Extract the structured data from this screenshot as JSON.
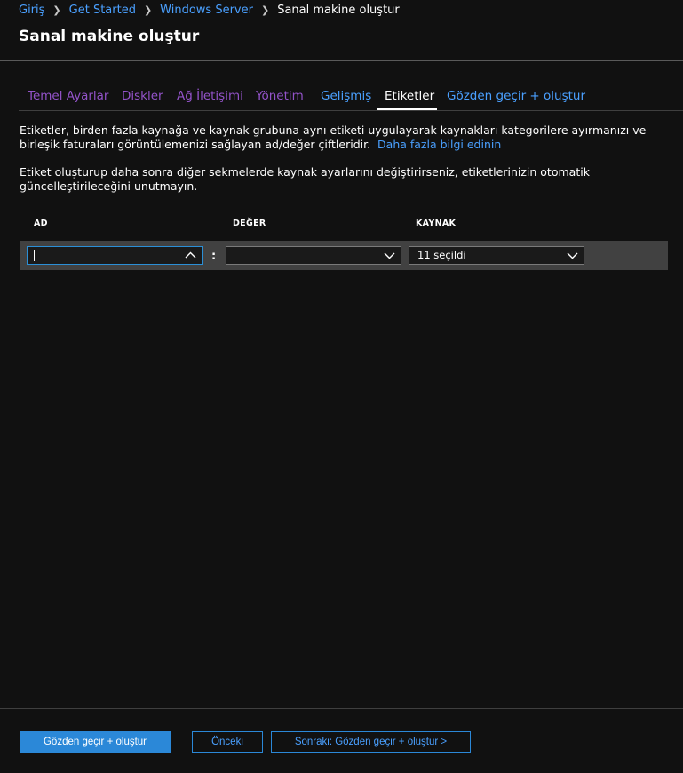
{
  "breadcrumb": {
    "items": [
      "Giriş",
      "Get Started",
      "Windows Server"
    ],
    "current": "Sanal makine oluştur"
  },
  "page": {
    "title": "Sanal makine oluştur"
  },
  "tabs": [
    {
      "label": "Temel Ayarlar",
      "state": "visited"
    },
    {
      "label": "Diskler",
      "state": "visited"
    },
    {
      "label": "Ağ İletişimi",
      "state": "visited"
    },
    {
      "label": "Yönetim",
      "state": "visited"
    },
    {
      "label": "Gelişmiş",
      "state": "link"
    },
    {
      "label": "Etiketler",
      "state": "active"
    },
    {
      "label": "Gözden geçir + oluştur",
      "state": "link"
    }
  ],
  "description": {
    "text": "Etiketler, birden fazla kaynağa ve kaynak grubuna aynı etiketi uygulayarak kaynakları kategorilere ayırmanızı ve birleşik faturaları görüntülemenizi sağlayan ad/değer çiftleridir.",
    "link": "Daha fazla bilgi edinin",
    "note": "Etiket oluşturup daha sonra diğer sekmelerde kaynak ayarlarını değiştirirseniz, etiketlerinizin otomatik güncelleştirileceğini unutmayın."
  },
  "table": {
    "headers": {
      "name": "AD",
      "value": "DEĞER",
      "resource": "KAYNAK"
    },
    "row": {
      "name": "",
      "separator": ":",
      "value": "",
      "resource": "11 seçildi"
    }
  },
  "footer": {
    "review_create": "Gözden geçir + oluştur",
    "previous": "Önceki",
    "next": "Sonraki: Gözden geçir + oluştur >"
  },
  "colors": {
    "background": "#111111",
    "link": "#4aa0ff",
    "visited": "#9353c9",
    "primary_button": "#2b88d8",
    "focus_border": "#2b8fd6",
    "row_background": "#414141"
  },
  "icons": {
    "breadcrumb_separator": "chevron-right-icon",
    "name_dropdown": "chevron-up-icon",
    "value_dropdown": "chevron-down-icon",
    "resource_dropdown": "chevron-down-icon"
  }
}
